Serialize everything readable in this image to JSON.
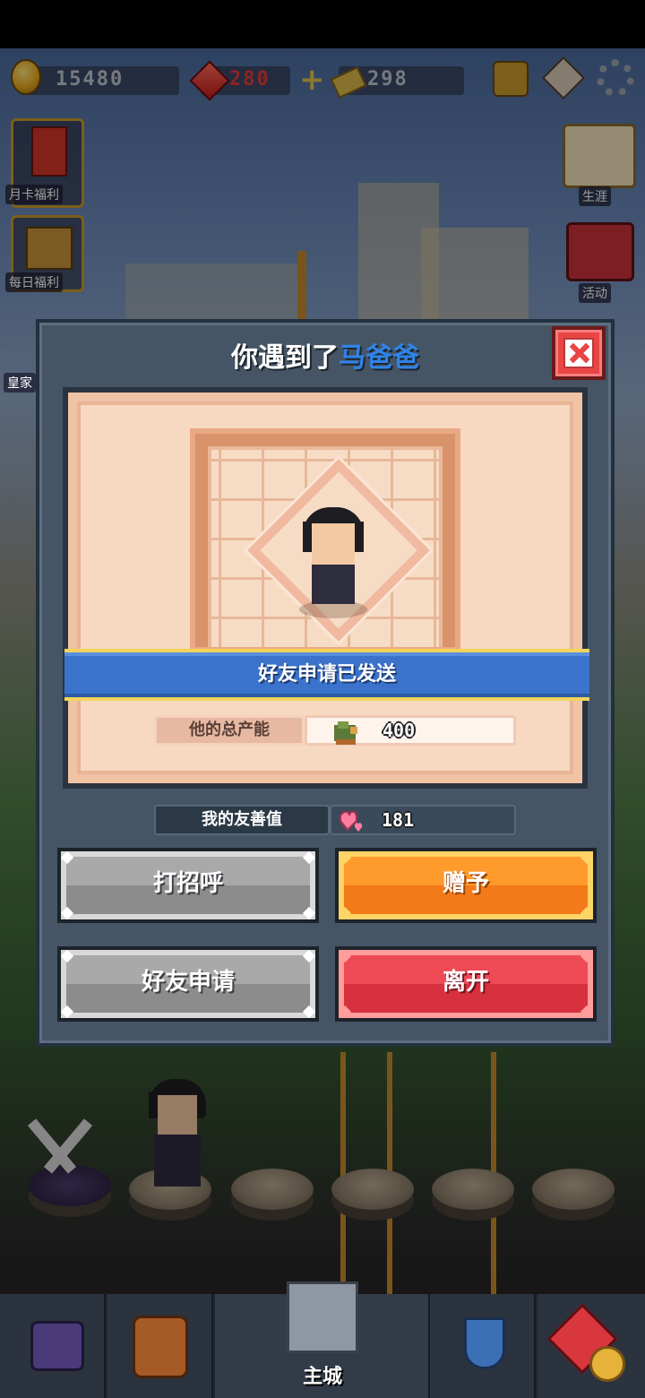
{
  "topbar": {
    "gold": "15480",
    "gems": "280",
    "tickets": "298"
  },
  "left_menu": {
    "monthly_card": "月卡福利",
    "daily_welfare": "每日福利",
    "royal": "皇家"
  },
  "right_menu": {
    "career": "生涯",
    "activity": "活动"
  },
  "dialog": {
    "title_prefix": "你遇到了",
    "title_name": "马爸爸",
    "banner": "好友申请已发送",
    "production_label": "他的总产能",
    "production_value": "400",
    "friendship_label": "我的友善值",
    "friendship_value": "181",
    "buttons": {
      "greet": "打招呼",
      "gift": "赠予",
      "friend_request": "好友申请",
      "leave": "离开"
    }
  },
  "bottom_nav": {
    "main_city": "主城"
  },
  "colors": {
    "title_name": "#2f84e6",
    "banner": "#3b73cc",
    "gift_button": "#ff9a2c",
    "leave_button": "#ee4a56",
    "gray_button": "#a9a9a9"
  }
}
